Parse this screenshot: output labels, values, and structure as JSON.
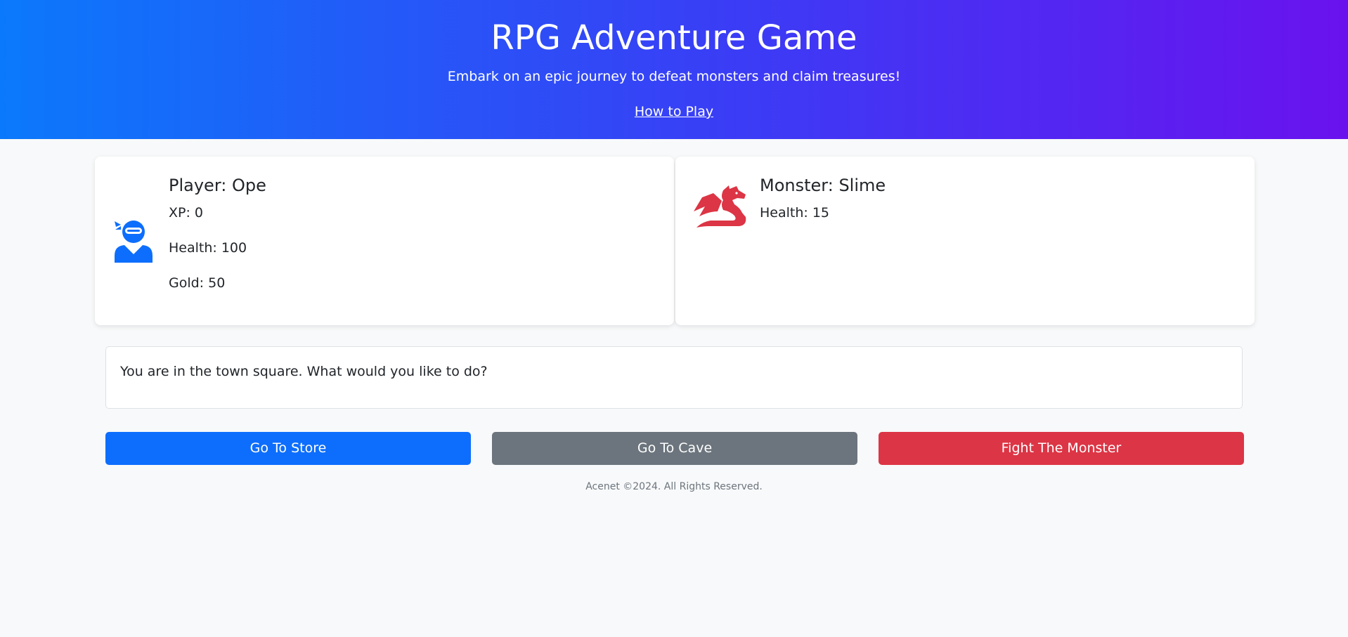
{
  "header": {
    "title": "RPG Adventure Game",
    "subtitle": "Embark on an epic journey to defeat monsters and claim treasures!",
    "how_to_play": "How to Play",
    "gradient_start": "#0b79fb",
    "gradient_end": "#6a12ee"
  },
  "player": {
    "name": "Player: Ope",
    "xp": "XP: 0",
    "health": "Health: 100",
    "gold": "Gold: 50",
    "icon": "ninja-icon",
    "icon_color": "#0d6efd"
  },
  "monster": {
    "name": "Monster: Slime",
    "health": "Health: 15",
    "icon": "dragon-icon",
    "icon_color": "#dc3545"
  },
  "message": "You are in the town square. What would you like to do?",
  "actions": [
    {
      "label": "Go To Store",
      "color": "#0d6efd"
    },
    {
      "label": "Go To Cave",
      "color": "#6c757d"
    },
    {
      "label": "Fight The Monster",
      "color": "#dc3545"
    }
  ],
  "footer": "Acenet ©2024. All Rights Reserved."
}
